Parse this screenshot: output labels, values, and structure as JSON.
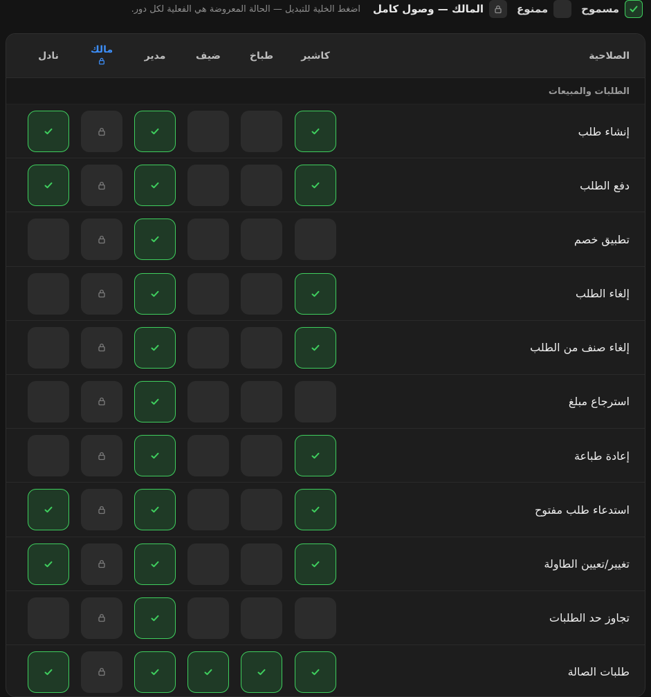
{
  "legend": {
    "allowed_label": "مسموح",
    "denied_label": "ممنوع",
    "owner_label": "المالك — وصول كامل",
    "hint": "اضغط الخلية للتبديل — الحالة المعروضة هي الفعلية لكل دور."
  },
  "table": {
    "permission_header": "الصلاحية",
    "columns": [
      {
        "key": "cashier",
        "label": "كاشير"
      },
      {
        "key": "cook",
        "label": "طباخ"
      },
      {
        "key": "guest",
        "label": "ضيف"
      },
      {
        "key": "manager",
        "label": "مدير"
      },
      {
        "key": "owner",
        "label": "مالك",
        "locked": true
      },
      {
        "key": "waiter",
        "label": "نادل"
      }
    ],
    "section_title": "الطلبات والمبيعات",
    "rows": [
      {
        "label": "إنشاء طلب",
        "cashier": true,
        "cook": false,
        "guest": false,
        "manager": true,
        "waiter": true
      },
      {
        "label": "دفع الطلب",
        "cashier": true,
        "cook": false,
        "guest": false,
        "manager": true,
        "waiter": true
      },
      {
        "label": "تطبيق خصم",
        "cashier": false,
        "cook": false,
        "guest": false,
        "manager": true,
        "waiter": false
      },
      {
        "label": "إلغاء الطلب",
        "cashier": true,
        "cook": false,
        "guest": false,
        "manager": true,
        "waiter": false
      },
      {
        "label": "إلغاء صنف من الطلب",
        "cashier": true,
        "cook": false,
        "guest": false,
        "manager": true,
        "waiter": false
      },
      {
        "label": "استرجاع مبلغ",
        "cashier": false,
        "cook": false,
        "guest": false,
        "manager": true,
        "waiter": false
      },
      {
        "label": "إعادة طباعة",
        "cashier": true,
        "cook": false,
        "guest": false,
        "manager": true,
        "waiter": false
      },
      {
        "label": "استدعاء طلب مفتوح",
        "cashier": true,
        "cook": false,
        "guest": false,
        "manager": true,
        "waiter": true
      },
      {
        "label": "تغيير/تعيين الطاولة",
        "cashier": true,
        "cook": false,
        "guest": false,
        "manager": true,
        "waiter": true
      },
      {
        "label": "تجاوز حد الطلبات",
        "cashier": false,
        "cook": false,
        "guest": false,
        "manager": true,
        "waiter": false
      },
      {
        "label": "طلبات الصالة",
        "cashier": true,
        "cook": true,
        "guest": true,
        "manager": true,
        "waiter": true
      }
    ]
  },
  "colors": {
    "allowed_border": "#3fcf5e",
    "allowed_fill": "#1f3a26",
    "cell_off": "#2c2c2c",
    "owner_accent": "#3d8ef7"
  }
}
